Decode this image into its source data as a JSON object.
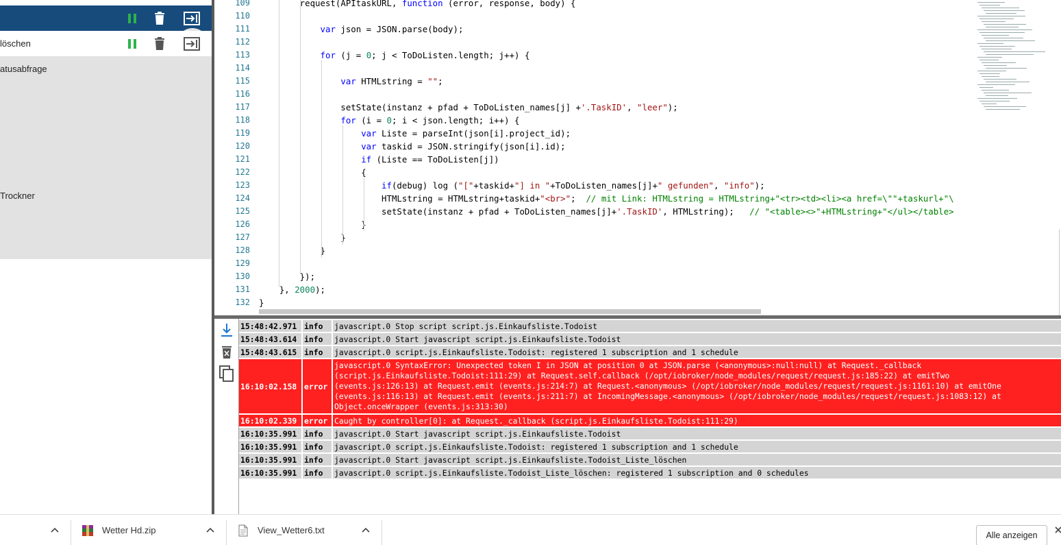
{
  "left_panel": {
    "row1": {
      "label": ""
    },
    "row2": {
      "label": "löschen"
    },
    "items": [
      "atusabfrage",
      "Trockner"
    ]
  },
  "editor": {
    "lines": [
      {
        "n": "109",
        "tokens": [
          {
            "t": "        request(APItaskURL, "
          },
          {
            "t": "function",
            "c": "kw"
          },
          {
            "t": " (error, response, body) {"
          }
        ]
      },
      {
        "n": "110",
        "tokens": [
          {
            "t": ""
          }
        ]
      },
      {
        "n": "111",
        "tokens": [
          {
            "t": "            "
          },
          {
            "t": "var",
            "c": "kw"
          },
          {
            "t": " json = JSON.parse(body);"
          }
        ]
      },
      {
        "n": "112",
        "tokens": [
          {
            "t": ""
          }
        ]
      },
      {
        "n": "113",
        "tokens": [
          {
            "t": "            "
          },
          {
            "t": "for",
            "c": "kw"
          },
          {
            "t": " (j = "
          },
          {
            "t": "0",
            "c": "num"
          },
          {
            "t": "; j < ToDoListen.length; j++) {"
          }
        ]
      },
      {
        "n": "114",
        "tokens": [
          {
            "t": ""
          }
        ]
      },
      {
        "n": "115",
        "tokens": [
          {
            "t": "                "
          },
          {
            "t": "var",
            "c": "kw"
          },
          {
            "t": " HTMLstring = "
          },
          {
            "t": "\"\"",
            "c": "str"
          },
          {
            "t": ";"
          }
        ]
      },
      {
        "n": "116",
        "tokens": [
          {
            "t": ""
          }
        ]
      },
      {
        "n": "117",
        "tokens": [
          {
            "t": "                setState(instanz + pfad + ToDoListen_names[j] +"
          },
          {
            "t": "'.TaskID'",
            "c": "str"
          },
          {
            "t": ", "
          },
          {
            "t": "\"leer\"",
            "c": "str"
          },
          {
            "t": ");"
          }
        ]
      },
      {
        "n": "118",
        "tokens": [
          {
            "t": "                "
          },
          {
            "t": "for",
            "c": "kw"
          },
          {
            "t": " (i = "
          },
          {
            "t": "0",
            "c": "num"
          },
          {
            "t": "; i < json.length; i++) {"
          }
        ]
      },
      {
        "n": "119",
        "tokens": [
          {
            "t": "                    "
          },
          {
            "t": "var",
            "c": "kw"
          },
          {
            "t": " Liste = parseInt(json[i].project_id);"
          }
        ]
      },
      {
        "n": "120",
        "tokens": [
          {
            "t": "                    "
          },
          {
            "t": "var",
            "c": "kw"
          },
          {
            "t": " taskid = JSON.stringify(json[i].id);"
          }
        ]
      },
      {
        "n": "121",
        "tokens": [
          {
            "t": "                    "
          },
          {
            "t": "if",
            "c": "kw"
          },
          {
            "t": " (Liste == ToDoListen[j])"
          }
        ]
      },
      {
        "n": "122",
        "tokens": [
          {
            "t": "                    {"
          }
        ]
      },
      {
        "n": "123",
        "tokens": [
          {
            "t": "                        "
          },
          {
            "t": "if",
            "c": "kw"
          },
          {
            "t": "(debug) log ("
          },
          {
            "t": "\"[\"",
            "c": "str"
          },
          {
            "t": "+taskid+"
          },
          {
            "t": "\"] in \"",
            "c": "str"
          },
          {
            "t": "+ToDoListen_names[j]+"
          },
          {
            "t": "\" gefunden\"",
            "c": "str"
          },
          {
            "t": ", "
          },
          {
            "t": "\"info\"",
            "c": "str"
          },
          {
            "t": ");"
          }
        ]
      },
      {
        "n": "124",
        "tokens": [
          {
            "t": "                        HTMLstring = HTMLstring+taskid+"
          },
          {
            "t": "\"<br>\"",
            "c": "str"
          },
          {
            "t": ";  "
          },
          {
            "t": "// mit Link: HTMLstring = HTMLstring+\"<tr><td><li><a href=\\\"\"+taskurl+\"\\",
            "c": "cmt"
          }
        ]
      },
      {
        "n": "125",
        "tokens": [
          {
            "t": "                        setState(instanz + pfad + ToDoListen_names[j]+"
          },
          {
            "t": "'.TaskID'",
            "c": "str"
          },
          {
            "t": ", HTMLstring);   "
          },
          {
            "t": "// \"<table><>\"+HTMLstring+\"</ul></table>",
            "c": "cmt"
          }
        ]
      },
      {
        "n": "126",
        "tokens": [
          {
            "t": "                    }"
          }
        ]
      },
      {
        "n": "127",
        "tokens": [
          {
            "t": "                }"
          }
        ]
      },
      {
        "n": "128",
        "tokens": [
          {
            "t": "            }"
          }
        ]
      },
      {
        "n": "129",
        "tokens": [
          {
            "t": ""
          }
        ]
      },
      {
        "n": "130",
        "tokens": [
          {
            "t": "        });"
          }
        ]
      },
      {
        "n": "131",
        "tokens": [
          {
            "t": "    }, "
          },
          {
            "t": "2000",
            "c": "num"
          },
          {
            "t": ");"
          }
        ]
      },
      {
        "n": "132",
        "tokens": [
          {
            "t": "}"
          }
        ]
      }
    ]
  },
  "log": {
    "rows": [
      {
        "time": "15:48:42.971",
        "severity": "info",
        "message": "javascript.0 Stop script script.js.Einkaufsliste.Todoist"
      },
      {
        "time": "15:48:43.614",
        "severity": "info",
        "message": "javascript.0 Start javascript script.js.Einkaufsliste.Todoist"
      },
      {
        "time": "15:48:43.615",
        "severity": "info",
        "message": "javascript.0 script.js.Einkaufsliste.Todoist: registered 1 subscription and 1 schedule"
      },
      {
        "time": "16:10:02.158",
        "severity": "error",
        "message": "javascript.0 SyntaxError: Unexpected token I in JSON at position 0 at JSON.parse (<anonymous>:null:null) at Request._callback\n(script.js.Einkaufsliste.Todoist:111:29) at Request.self.callback (/opt/iobroker/node_modules/request/request.js:185:22) at emitTwo\n(events.js:126:13) at Request.emit (events.js:214:7) at Request.<anonymous> (/opt/iobroker/node_modules/request/request.js:1161:10) at emitOne\n(events.js:116:13) at Request.emit (events.js:211:7) at IncomingMessage.<anonymous> (/opt/iobroker/node_modules/request/request.js:1083:12) at\nObject.onceWrapper (events.js:313:30)"
      },
      {
        "time": "16:10:02.339",
        "severity": "error",
        "message": "Caught by controller[0]: at Request._callback (script.js.Einkaufsliste.Todoist:111:29)"
      },
      {
        "time": "16:10:35.991",
        "severity": "info",
        "message": "javascript.0 Start javascript script.js.Einkaufsliste.Todoist"
      },
      {
        "time": "16:10:35.991",
        "severity": "info",
        "message": "javascript.0 script.js.Einkaufsliste.Todoist: registered 1 subscription and 1 schedule"
      },
      {
        "time": "16:10:35.991",
        "severity": "info",
        "message": "javascript.0 Start javascript script.js.Einkaufsliste.Todoist_Liste_löschen"
      },
      {
        "time": "16:10:35.991",
        "severity": "info",
        "message": "javascript.0 script.js.Einkaufsliste.Todoist_Liste_löschen: registered 1 subscription and 0 schedules"
      }
    ]
  },
  "downloads": {
    "items": [
      {
        "name": "Wetter Hd.zip",
        "icon": "archive-icon"
      },
      {
        "name": "View_Wetter6.txt",
        "icon": "text-file-icon"
      }
    ],
    "show_all_label": "Alle anzeigen"
  },
  "colors": {
    "header_blue": "#164b7c",
    "pause_green": "#2db34a",
    "error_red": "#ff2020",
    "line_number": "#237893"
  }
}
